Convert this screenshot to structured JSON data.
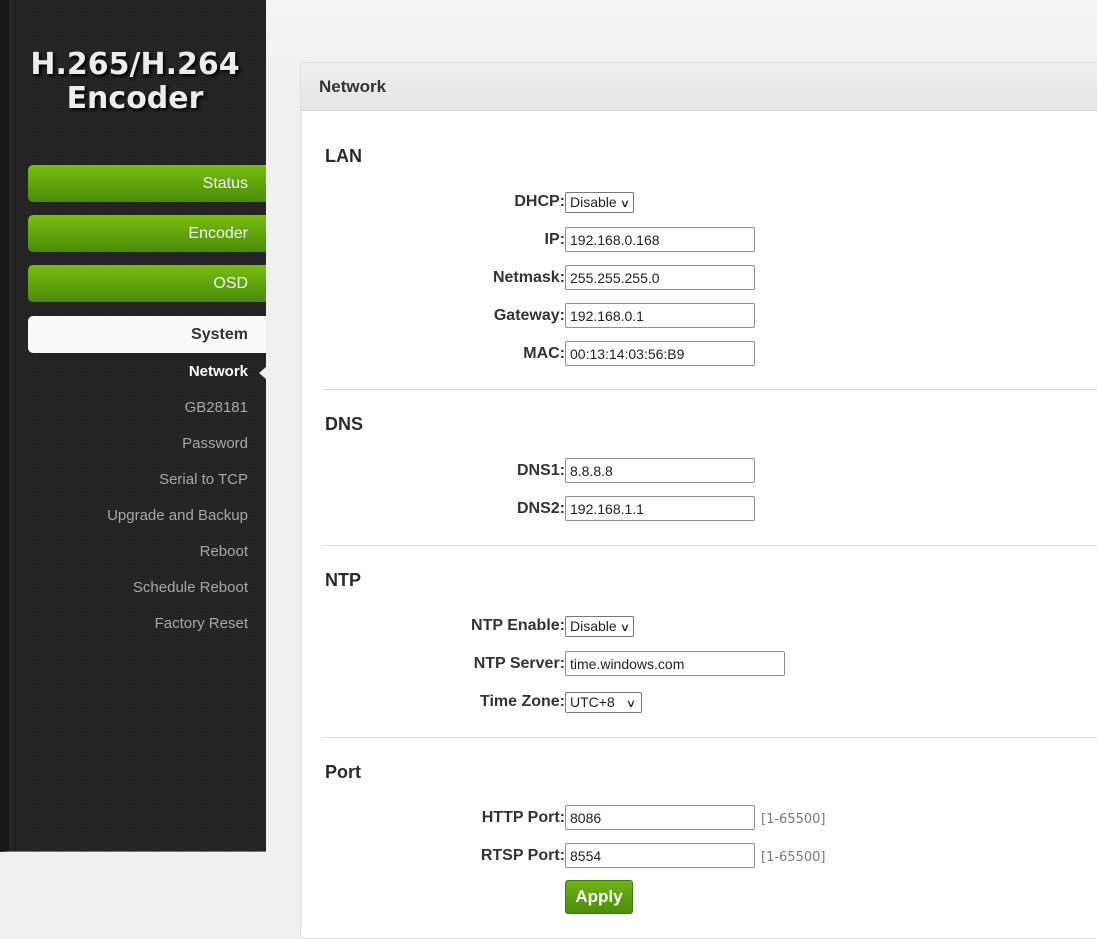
{
  "app": {
    "logo_line1": "H.265/H.264",
    "logo_line2": "Encoder"
  },
  "sidebar": {
    "menu": [
      {
        "label": "Status",
        "active": false
      },
      {
        "label": "Encoder",
        "active": false
      },
      {
        "label": "OSD",
        "active": false
      },
      {
        "label": "System",
        "active": true
      }
    ],
    "submenu": [
      {
        "label": "Network",
        "current": true
      },
      {
        "label": "GB28181",
        "current": false
      },
      {
        "label": "Password",
        "current": false
      },
      {
        "label": "Serial to TCP",
        "current": false
      },
      {
        "label": "Upgrade and Backup",
        "current": false
      },
      {
        "label": "Reboot",
        "current": false
      },
      {
        "label": "Schedule Reboot",
        "current": false
      },
      {
        "label": "Factory Reset",
        "current": false
      }
    ]
  },
  "panel": {
    "title": "Network",
    "lan": {
      "title": "LAN",
      "dhcp": {
        "label": "DHCP:",
        "value": "Disable"
      },
      "ip": {
        "label": "IP:",
        "value": "192.168.0.168"
      },
      "netmask": {
        "label": "Netmask:",
        "value": "255.255.255.0"
      },
      "gateway": {
        "label": "Gateway:",
        "value": "192.168.0.1"
      },
      "mac": {
        "label": "MAC:",
        "value": "00:13:14:03:56:B9"
      }
    },
    "dns": {
      "title": "DNS",
      "dns1": {
        "label": "DNS1:",
        "value": "8.8.8.8"
      },
      "dns2": {
        "label": "DNS2:",
        "value": "192.168.1.1"
      }
    },
    "ntp": {
      "title": "NTP",
      "enable": {
        "label": "NTP Enable:",
        "value": "Disable"
      },
      "server": {
        "label": "NTP Server:",
        "value": "time.windows.com"
      },
      "timezone": {
        "label": "Time Zone:",
        "value": "UTC+8"
      }
    },
    "port": {
      "title": "Port",
      "http": {
        "label": "HTTP Port:",
        "value": "8086",
        "range": "[1-65500]"
      },
      "rtsp": {
        "label": "RTSP Port:",
        "value": "8554",
        "range": "[1-65500]"
      }
    },
    "apply_label": "Apply"
  },
  "colors": {
    "accent_green": "#5ea30c",
    "sidebar_bg": "#222222"
  }
}
